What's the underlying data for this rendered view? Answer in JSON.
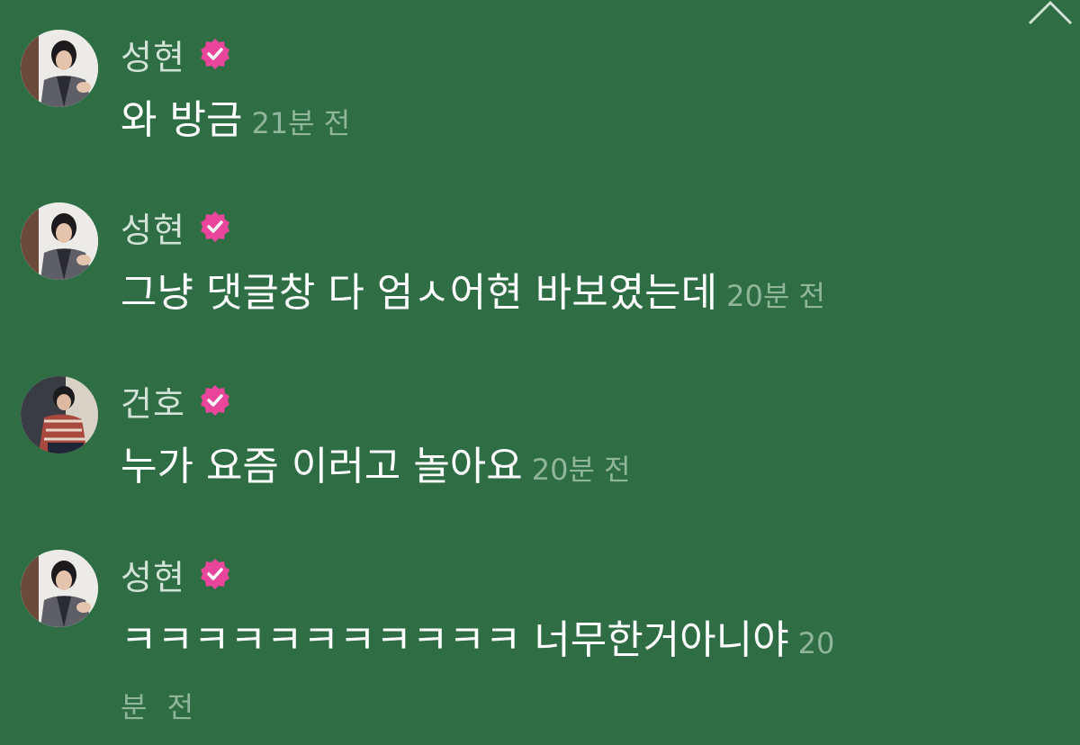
{
  "comments": [
    {
      "author": "성현",
      "text": "와 방금",
      "time": "21분 전",
      "avatar_icon": "profile-photo-sunghyun"
    },
    {
      "author": "성현",
      "text": "그냥 댓글창 다 엄ㅅ어현 바보였는데",
      "time": "20분 전",
      "avatar_icon": "profile-photo-sunghyun"
    },
    {
      "author": "건호",
      "text": "누가 요즘 이러고 놀아요",
      "time": "20분 전",
      "avatar_icon": "profile-photo-geonho"
    },
    {
      "author": "성현",
      "text": "ㅋㅋㅋㅋㅋㅋㅋㅋㅋㅋㅋ 너무한거아니야",
      "time_part1": "20",
      "time_part2": "분 전",
      "avatar_icon": "profile-photo-sunghyun"
    }
  ],
  "icons": {
    "verified": "verified-badge-icon",
    "collapse": "chevron-up-icon"
  },
  "colors": {
    "background": "#2f6e45",
    "verified_badge": "#e8459b",
    "name": "#d3e2d7",
    "timestamp": "#8fb59a",
    "message": "#ffffff"
  }
}
